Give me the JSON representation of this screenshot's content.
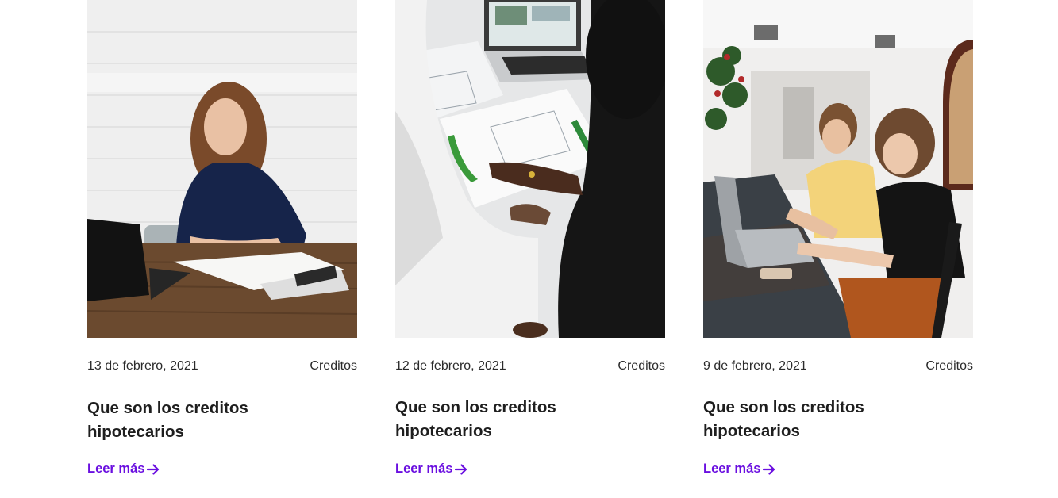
{
  "blog": {
    "cards": [
      {
        "image_alt": "woman-at-desk-photo",
        "date": "13 de febrero, 2021",
        "category": "Creditos",
        "title": "Que son los creditos hipotecarios",
        "read_more": "Leer más"
      },
      {
        "image_alt": "people-reviewing-plans-photo",
        "date": "12 de febrero, 2021",
        "category": "Creditos",
        "title": "Que son los creditos hipotecarios",
        "read_more": "Leer más"
      },
      {
        "image_alt": "women-working-laptop-photo",
        "date": "9 de febrero, 2021",
        "category": "Creditos",
        "title": "Que son los creditos hipotecarios",
        "read_more": "Leer más"
      }
    ]
  },
  "colors": {
    "accent": "#6a0fe0",
    "text": "#1e1e1e",
    "meta_text": "#2b2b2b",
    "background": "#ffffff"
  },
  "icons": {
    "read_more_icon": "arrow-right-icon"
  }
}
